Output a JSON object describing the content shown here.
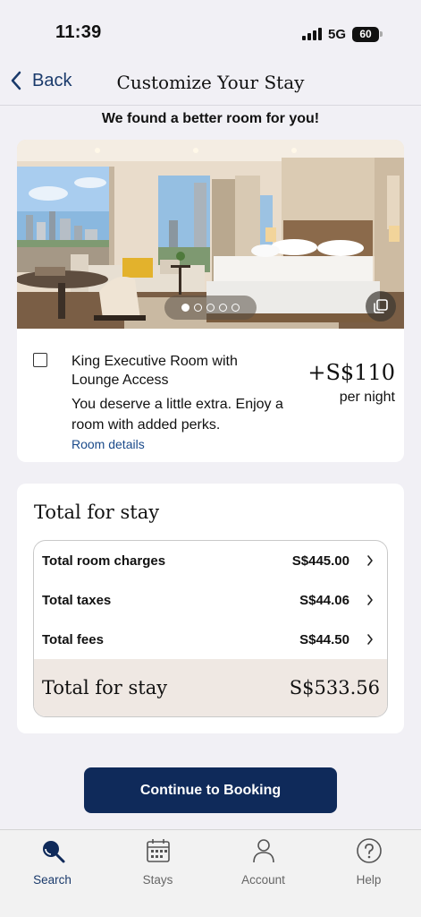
{
  "status_bar": {
    "time": "11:39",
    "network": "5G",
    "battery": "60"
  },
  "header": {
    "back_label": "Back",
    "title": "Customize Your Stay"
  },
  "banner": "We found a better room for you!",
  "room_offer": {
    "name": "King Executive Room with Lounge Access",
    "description": "You deserve a little extra. Enjoy a room with added perks.",
    "details_link": "Room details",
    "price": "+S$110",
    "price_unit": "per night",
    "photo_count": 5,
    "active_photo": 1,
    "checked": false
  },
  "total": {
    "heading": "Total for stay",
    "rows": [
      {
        "label": "Total room charges",
        "value": "S$445.00"
      },
      {
        "label": "Total taxes",
        "value": "S$44.06"
      },
      {
        "label": "Total fees",
        "value": "S$44.50"
      }
    ],
    "grand_label": "Total for stay",
    "grand_value": "S$533.56"
  },
  "cta": "Continue to Booking",
  "tabs": [
    {
      "label": "Search",
      "icon": "search-icon",
      "active": true
    },
    {
      "label": "Stays",
      "icon": "calendar-icon",
      "active": false
    },
    {
      "label": "Account",
      "icon": "person-icon",
      "active": false
    },
    {
      "label": "Help",
      "icon": "help-icon",
      "active": false
    }
  ],
  "colors": {
    "primary": "#0f2a5a",
    "link": "#1a4a8a",
    "grand_total_bg": "#efe8e3",
    "page_bg": "#f1f0f5"
  }
}
